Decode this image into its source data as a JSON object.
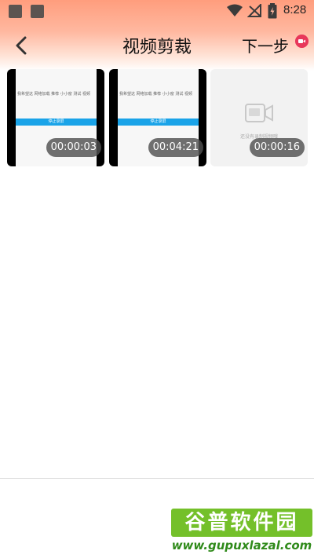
{
  "status_bar": {
    "time": "8:28",
    "icons": [
      "notification-square-icon",
      "notification-square-icon",
      "wifi-icon",
      "no-signal-icon",
      "battery-charging-icon"
    ]
  },
  "header": {
    "back_icon": "chevron-left-icon",
    "title": "视频剪裁",
    "next_label": "下一步"
  },
  "videos": [
    {
      "duration": "00:00:03",
      "screen_text": "我希望这 网络加载 推荐 小小窗 测试 视频",
      "screen_button": "停止录屏"
    },
    {
      "duration": "00:04:21",
      "screen_text": "我希望这 网络加载 推荐 小小窗 测试 视频",
      "screen_button": "停止录屏"
    },
    {
      "duration": "00:00:16",
      "placeholder_text": "还没有录制视频哦",
      "icon": "video-camera-icon"
    }
  ],
  "watermark": {
    "title": "谷普软件园",
    "url": "www.gupuxlazal.com"
  },
  "colors": {
    "header_gradient_top": "#ff9d7d",
    "screen_bar": "#1aa3e8",
    "rec_badge": "#e8375a",
    "watermark_green": "#74c02a"
  }
}
